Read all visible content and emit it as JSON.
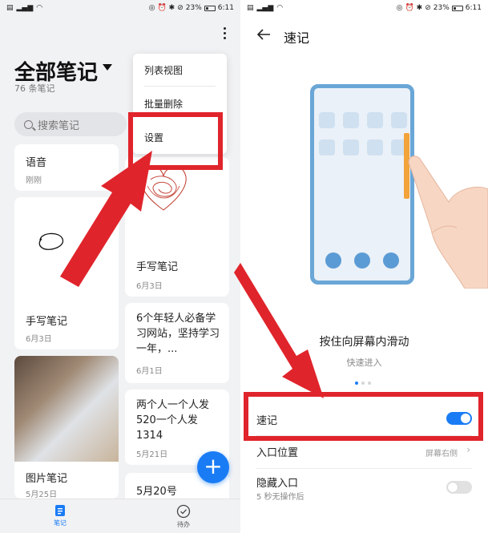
{
  "colors": {
    "accent": "#1a7cf5",
    "annotation": "#e0242b",
    "phone_frame": "#6aa6d6",
    "side_bar": "#f2a33a"
  },
  "status_bar": {
    "battery": "23%",
    "time": "6:11"
  },
  "left": {
    "title": "全部笔记",
    "count": "76 条笔记",
    "search_placeholder": "搜索笔记",
    "menu": [
      "列表视图",
      "批量删除",
      "设置"
    ],
    "notes": [
      {
        "title": "语音",
        "date": "刚刚"
      },
      {
        "title": "手写笔记",
        "date": "6月3日"
      },
      {
        "title": "手写笔记",
        "date": "6月3日"
      },
      {
        "title": "6个年轻人必备学习网站，坚持学习一年，...",
        "date": "6月1日"
      },
      {
        "title": "图片笔记",
        "date": "5月25日"
      },
      {
        "title": "两个人一个人发520一个人发1314",
        "date": "5月21日"
      },
      {
        "title": "5月20号",
        "date": ""
      }
    ],
    "nav": [
      {
        "label": "笔记",
        "icon": "note-icon",
        "active": true
      },
      {
        "label": "待办",
        "icon": "todo-check-icon",
        "active": false
      }
    ],
    "fab_label": "+"
  },
  "right": {
    "title": "速记",
    "tip_title": "按住向屏幕内滑动",
    "tip_sub": "快速进入",
    "settings": [
      {
        "label": "速记",
        "toggle": true
      },
      {
        "label": "入口位置",
        "value": "屏幕右侧"
      },
      {
        "label": "隐藏入口",
        "sub": "5 秒无操作后",
        "toggle": false
      }
    ]
  }
}
